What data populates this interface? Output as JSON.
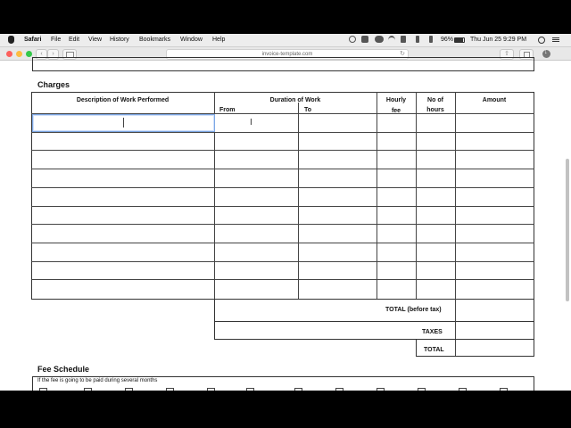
{
  "menubar": {
    "app_name": "Safari",
    "items": [
      "File",
      "Edit",
      "View",
      "History",
      "Bookmarks",
      "Window",
      "Help"
    ],
    "battery": "96%",
    "datetime": "Thu Jun 25  9:29 PM",
    "status_icons": [
      "clock-icon",
      "record-icon",
      "cloud-icon",
      "wifi-icon",
      "volume-icon",
      "bluetooth-icon",
      "battery-icon",
      "search-icon",
      "list-icon"
    ]
  },
  "toolbar": {
    "url": "invoice-template.com",
    "buttons": [
      "back-button",
      "forward-button",
      "sidebar-button",
      "reload-button",
      "share-button",
      "tabs-button",
      "download-button"
    ]
  },
  "charges": {
    "title": "Charges",
    "headers": {
      "description": "Description of Work Performed",
      "duration": "Duration of Work",
      "from": "From",
      "to": "To",
      "hourly_line1": "Hourly",
      "hourly_line2": "fee",
      "hours_line1": "No of",
      "hours_line2": "hours",
      "amount": "Amount"
    },
    "row_count": 10,
    "total_before_tax": "TOTAL (before tax)",
    "taxes": "TAXES",
    "total": "TOTAL"
  },
  "fee_schedule": {
    "title": "Fee Schedule",
    "note": "If the fee is going to be paid during several months"
  },
  "colors": {
    "focus_border": "#7ea8e5",
    "close": "#fc605c",
    "minimize": "#fdbc40",
    "zoom": "#34c84a"
  }
}
